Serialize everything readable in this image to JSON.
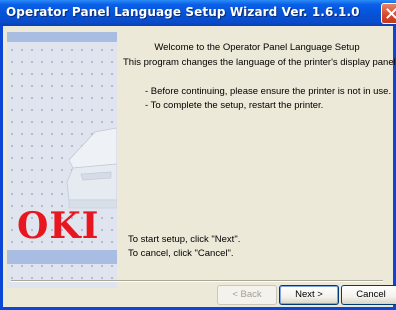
{
  "window": {
    "title": "Operator Panel Language Setup Wizard Ver. 1.6.1.0"
  },
  "welcome": {
    "title": "Welcome to the Operator Panel Language Setup",
    "description": "This program changes the language of the printer's display panel."
  },
  "notes": [
    "- Before continuing, please ensure the printer is not in use.",
    "- To complete the setup, restart the printer."
  ],
  "instructions": {
    "start": "To start setup, click \"Next\".",
    "cancel": "To cancel, click \"Cancel\"."
  },
  "brand": {
    "logo": "OKI",
    "color": "#e8171f"
  },
  "buttons": {
    "back": "< Back",
    "next": "Next >",
    "cancel": "Cancel",
    "back_enabled": false
  },
  "colors": {
    "titlebar": "#0453d6",
    "dialog_bg": "#ece9d8",
    "side_panel": "#dfe4ee",
    "side_band": "#a9bde3"
  },
  "icons": {
    "close": "close-icon"
  }
}
